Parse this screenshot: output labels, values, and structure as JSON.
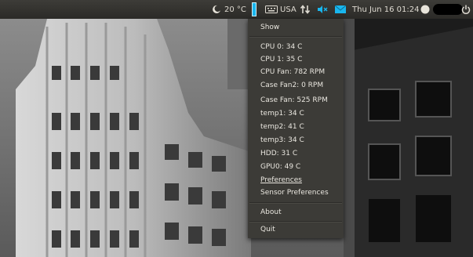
{
  "panel": {
    "weather": "20 °C",
    "keyboard_layout": "USA",
    "datetime": "Thu Jun 16 01:24",
    "user_name": ""
  },
  "menu": {
    "show": "Show",
    "sensors": [
      "CPU 0: 34 C",
      "CPU 1: 35 C",
      "CPU Fan: 782 RPM",
      "Case Fan2:  0 RPM",
      "Case Fan: 525 RPM",
      "temp1: 34 C",
      "temp2: 41 C",
      "temp3: 34 C",
      "HDD: 31 C",
      "GPU0: 49 C"
    ],
    "preferences": "Preferences",
    "sensor_preferences": "Sensor Preferences",
    "about": "About",
    "quit": "Quit"
  },
  "icons": {
    "weather": "moon-cloud-icon",
    "keyboard": "keyboard-icon",
    "network": "network-arrows-icon",
    "volume": "volume-muted-icon",
    "mail": "mail-icon",
    "sensor_indicator": "thermometer-bar-icon",
    "user": "user-presence-icon",
    "power": "power-icon"
  },
  "colors": {
    "panel": "#3c3b37",
    "menu": "#3c3b37",
    "accent": "#19b6ee"
  }
}
